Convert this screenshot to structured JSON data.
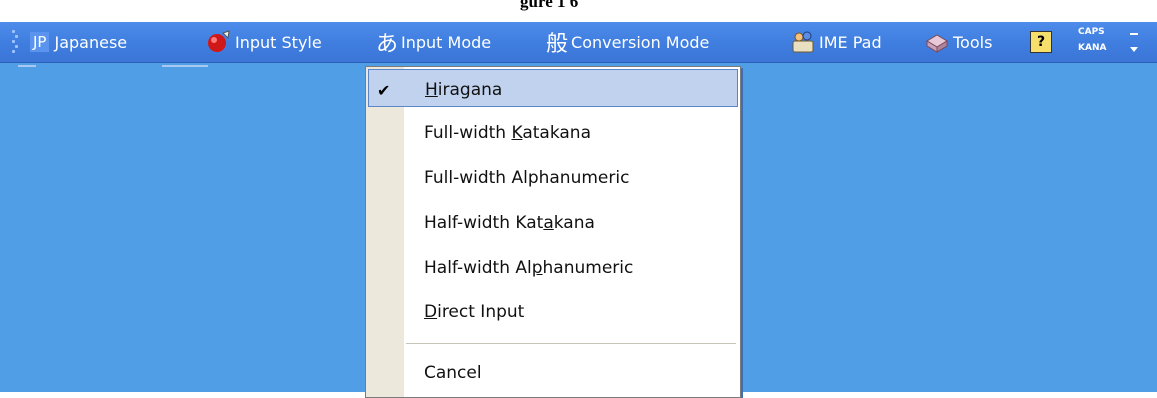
{
  "caption": {
    "text": "gure 1 6"
  },
  "language_bar": {
    "language_code": "JP",
    "language_name": "Japanese",
    "input_style_label": "Input Style",
    "input_mode_label": "Input Mode",
    "input_mode_glyph": "あ",
    "conversion_mode_label": "Conversion Mode",
    "conversion_mode_glyph": "般",
    "ime_pad_label": "IME Pad",
    "tools_label": "Tools",
    "help_glyph": "?",
    "caps_label": "CAPS",
    "kana_label": "KANA"
  },
  "icons": {
    "input_style": "red-ball-input-style-icon",
    "ime_pad": "ime-pad-icon",
    "tools": "toolbox-icon",
    "help": "help-icon"
  },
  "input_mode_menu": {
    "items": [
      {
        "pre": "",
        "key": "H",
        "post": "iragana",
        "checked": true,
        "selected": true
      },
      {
        "pre": "Full-width ",
        "key": "K",
        "post": "atakana",
        "checked": false,
        "selected": false
      },
      {
        "pre": "Full-width Alphanumeric",
        "key": "",
        "post": "",
        "checked": false,
        "selected": false
      },
      {
        "pre": "Half-width Kat",
        "key": "a",
        "post": "kana",
        "checked": false,
        "selected": false
      },
      {
        "pre": "Half-width Al",
        "key": "p",
        "post": "hanumeric",
        "checked": false,
        "selected": false
      },
      {
        "pre": "",
        "key": "D",
        "post": "irect Input",
        "checked": false,
        "selected": false
      },
      {
        "pre": "Cancel",
        "key": "",
        "post": "",
        "checked": false,
        "selected": false
      }
    ],
    "check_glyph": "✔"
  },
  "colors": {
    "desktop": "#509ee6",
    "language_bar": "#3f7ddf",
    "menu_highlight": "#c1d2ee",
    "menu_gutter": "#ece8db"
  }
}
